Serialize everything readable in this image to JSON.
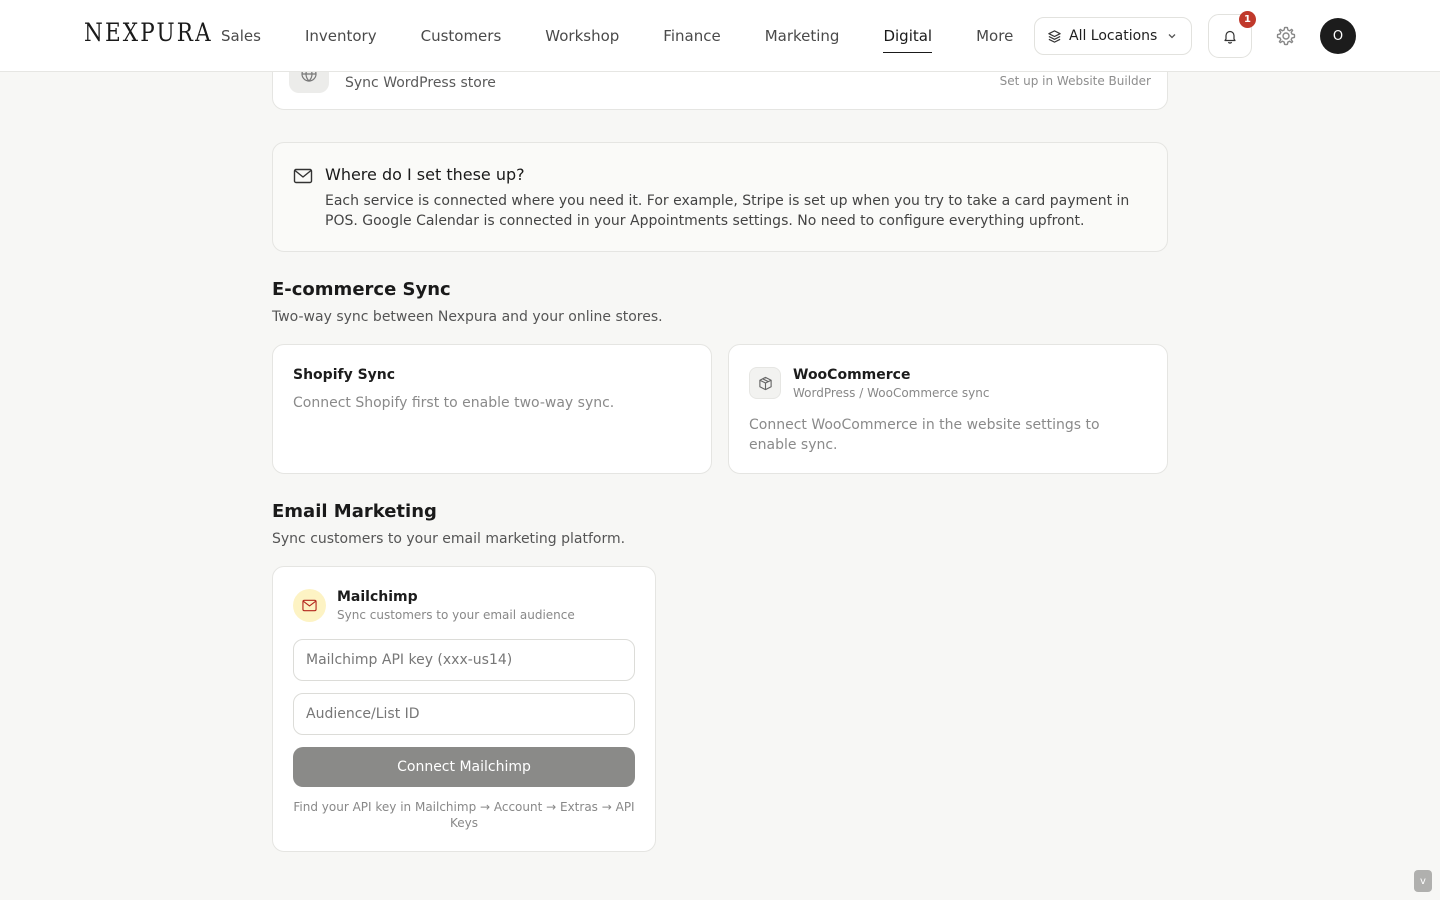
{
  "brand": {
    "logo": "NEXPURA"
  },
  "nav": {
    "items": [
      {
        "label": "Sales"
      },
      {
        "label": "Inventory"
      },
      {
        "label": "Customers"
      },
      {
        "label": "Workshop"
      },
      {
        "label": "Finance"
      },
      {
        "label": "Marketing"
      },
      {
        "label": "Digital",
        "active": true
      },
      {
        "label": "More"
      }
    ]
  },
  "header": {
    "location_label": "All Locations",
    "notification_count": "1",
    "avatar_initial": "O"
  },
  "wordpress_card": {
    "subtitle": "Sync WordPress store",
    "right_text": "Set up in Website Builder"
  },
  "info": {
    "title": "Where do I set these up?",
    "body": "Each service is connected where you need it. For example, Stripe is set up when you try to take a card payment in POS. Google Calendar is connected in your Appointments settings. No need to configure everything upfront."
  },
  "ecommerce": {
    "title": "E-commerce Sync",
    "subtitle": "Two-way sync between Nexpura and your online stores.",
    "shopify": {
      "title": "Shopify Sync",
      "description": "Connect Shopify first to enable two-way sync."
    },
    "woocommerce": {
      "title": "WooCommerce",
      "subtitle": "WordPress / WooCommerce sync",
      "description": "Connect WooCommerce in the website settings to enable sync."
    }
  },
  "email_marketing": {
    "title": "Email Marketing",
    "subtitle": "Sync customers to your email marketing platform.",
    "mailchimp": {
      "title": "Mailchimp",
      "subtitle": "Sync customers to your email audience",
      "api_key_placeholder": "Mailchimp API key (xxx-us14)",
      "list_id_placeholder": "Audience/List ID",
      "connect_label": "Connect Mailchimp",
      "help": "Find your API key in Mailchimp → Account → Extras → API Keys"
    }
  },
  "corner_button_label": "v",
  "colors": {
    "background": "#f7f7f5",
    "badge": "#c0392b",
    "button_disabled": "#8a8a88",
    "mailchimp_icon_bg": "#fdf3c4"
  }
}
